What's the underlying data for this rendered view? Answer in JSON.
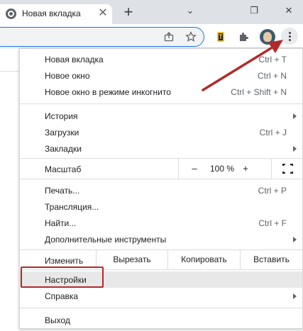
{
  "browser": {
    "tab_title": "Новая вкладка",
    "tab_close_glyph": "✕",
    "new_tab_glyph": "+",
    "window_controls": [
      "⌄",
      "❐",
      "✕"
    ]
  },
  "toolbar": {
    "icons": [
      "share-icon",
      "bookmark-star-icon",
      "extension-logo-icon",
      "puzzle-extensions-icon",
      "profile-avatar",
      "more-menu-icon"
    ]
  },
  "menu": {
    "group1": [
      {
        "label": "Новая вкладка",
        "shortcut": "Ctrl + T"
      },
      {
        "label": "Новое окно",
        "shortcut": "Ctrl + N"
      },
      {
        "label": "Новое окно в режиме инкогнито",
        "shortcut": "Ctrl + Shift + N"
      }
    ],
    "group2": [
      {
        "label": "История",
        "shortcut": ""
      },
      {
        "label": "Загрузки",
        "shortcut": "Ctrl + J"
      },
      {
        "label": "Закладки",
        "shortcut": ""
      }
    ],
    "zoom": {
      "label": "Масштаб",
      "minus": "–",
      "value": "100 %",
      "plus": "+"
    },
    "group3": [
      {
        "label": "Печать...",
        "shortcut": "Ctrl + P"
      },
      {
        "label": "Трансляция...",
        "shortcut": ""
      },
      {
        "label": "Найти...",
        "shortcut": "Ctrl + F"
      },
      {
        "label": "Дополнительные инструменты",
        "shortcut": ""
      }
    ],
    "edit": {
      "label": "Изменить",
      "cut": "Вырезать",
      "copy": "Копировать",
      "paste": "Вставить"
    },
    "group4": [
      {
        "label": "Настройки",
        "shortcut": ""
      },
      {
        "label": "Справка",
        "shortcut": ""
      }
    ],
    "exit": {
      "label": "Выход"
    }
  },
  "colors": {
    "annotation_red": "#b02a2a",
    "highlight": "#e8e8e8",
    "tabstrip": "#dee1e6",
    "focus_blue": "#1a73e8"
  }
}
